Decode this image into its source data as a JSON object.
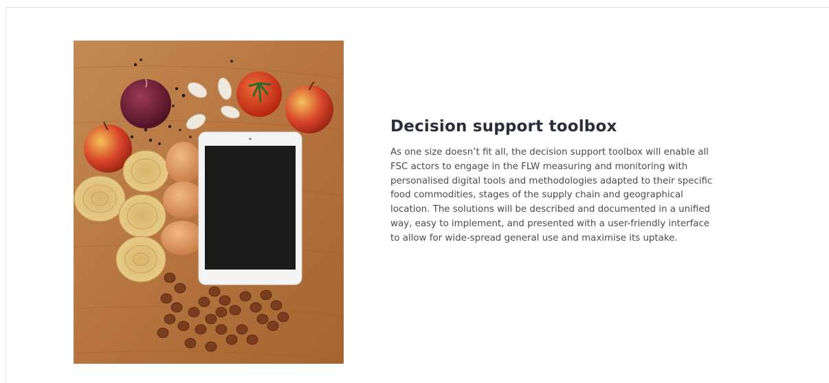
{
  "section": {
    "title": "Decision support toolbox",
    "body": "As one size doesn’t fit all, the decision support toolbox will enable all FSC actors to engage in the FLW measuring and monitoring with personalised digital tools and methodologies adapted to their specific food commodities, stages of the supply chain and geographical location. The solutions will be described and documented in a unified way, easy to implement, and presented with a user-friendly interface to allow for wide-spread general use and maximise its uptake."
  },
  "colors": {
    "title": "#2b2d3a",
    "body_text": "#4a4a4a",
    "wood": "#b97a45",
    "tablet_screen": "#1b1b1b"
  },
  "icons": {
    "photo": "food-ingredients-with-tablet"
  }
}
